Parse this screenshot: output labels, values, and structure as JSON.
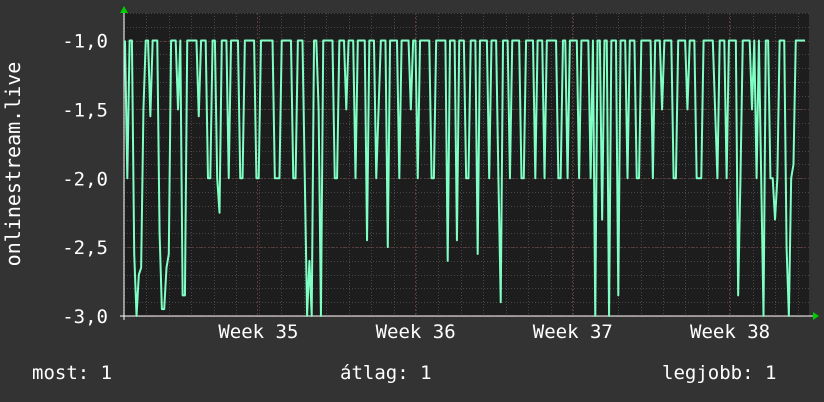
{
  "chart_data": {
    "type": "line",
    "ylabel": "onlinestream.live",
    "y_ticks": [
      "-1,0",
      "-1,5",
      "-2,0",
      "-2,5",
      "-3,0"
    ],
    "y_tick_values": [
      -1.0,
      -1.5,
      -2.0,
      -2.5,
      -3.0
    ],
    "ylim": [
      -3.0,
      -0.8
    ],
    "x_ticks": [
      "Week 35",
      "Week 36",
      "Week 37",
      "Week 38"
    ],
    "x_tick_positions_days": [
      5.94,
      12.94,
      19.94,
      26.94
    ],
    "xlim_days": [
      0,
      30.5
    ],
    "grid": true,
    "colors": {
      "background": "#333333",
      "plot": "#1d1d1d",
      "line": "#7fffc4",
      "axis_arrow": "#00cc00",
      "grid": "#474747"
    },
    "series": [
      {
        "values": [
          -1.0,
          -2.0,
          -1.0,
          -1.0,
          -2.55,
          -3.0,
          -2.7,
          -2.65,
          -1.5,
          -1.0,
          -1.0,
          -1.55,
          -1.0,
          -1.0,
          -1.0,
          -2.4,
          -2.95,
          -2.95,
          -2.65,
          -2.55,
          -1.0,
          -1.0,
          -1.0,
          -1.5,
          -1.0,
          -2.85,
          -2.85,
          -1.0,
          -1.0,
          -1.0,
          -1.0,
          -1.0,
          -1.55,
          -1.0,
          -1.0,
          -1.0,
          -2.0,
          -2.0,
          -1.0,
          -1.0,
          -2.0,
          -2.25,
          -1.0,
          -1.0,
          -1.0,
          -2.0,
          -1.0,
          -1.0,
          -1.0,
          -1.0,
          -2.0,
          -2.0,
          -1.0,
          -1.0,
          -1.0,
          -1.0,
          -1.0,
          -2.0,
          -2.0,
          -1.0,
          -1.0,
          -1.0,
          -1.0,
          -1.0,
          -1.0,
          -2.0,
          -2.0,
          -2.0,
          -1.0,
          -1.0,
          -1.0,
          -1.0,
          -1.0,
          -2.0,
          -2.0,
          -1.0,
          -1.0,
          -1.0,
          -2.0,
          -3.0,
          -2.6,
          -3.0,
          -1.0,
          -1.0,
          -1.5,
          -3.0,
          -1.0,
          -1.0,
          -1.0,
          -1.0,
          -1.0,
          -2.0,
          -2.0,
          -1.0,
          -1.0,
          -1.0,
          -1.5,
          -1.0,
          -1.0,
          -1.0,
          -2.0,
          -1.0,
          -1.0,
          -1.0,
          -1.0,
          -2.45,
          -1.0,
          -1.0,
          -1.0,
          -2.0,
          -1.5,
          -1.0,
          -1.0,
          -1.0,
          -2.5,
          -1.0,
          -1.0,
          -1.0,
          -1.0,
          -2.0,
          -1.0,
          -1.0,
          -1.0,
          -1.0,
          -1.5,
          -1.0,
          -1.0,
          -2.0,
          -1.0,
          -1.0,
          -1.0,
          -1.0,
          -1.0,
          -2.0,
          -2.0,
          -1.0,
          -1.0,
          -1.0,
          -1.0,
          -1.0,
          -2.6,
          -1.0,
          -1.0,
          -1.0,
          -2.45,
          -1.0,
          -1.0,
          -1.0,
          -2.0,
          -2.0,
          -1.0,
          -1.0,
          -1.0,
          -2.55,
          -1.0,
          -1.0,
          -1.0,
          -1.0,
          -2.0,
          -1.0,
          -1.0,
          -1.0,
          -2.0,
          -2.9,
          -1.0,
          -1.0,
          -1.0,
          -2.0,
          -1.0,
          -1.0,
          -1.0,
          -1.0,
          -2.0,
          -2.0,
          -1.0,
          -1.0,
          -1.0,
          -1.0,
          -2.0,
          -1.0,
          -1.0,
          -1.0,
          -2.0,
          -1.0,
          -1.0,
          -1.0,
          -1.0,
          -1.0,
          -2.0,
          -2.0,
          -1.0,
          -1.0,
          -2.0,
          -1.0,
          -1.0,
          -1.0,
          -1.0,
          -2.0,
          -1.0,
          -1.0,
          -1.0,
          -1.0,
          -2.0,
          -1.0,
          -3.0,
          -1.0,
          -1.0,
          -2.3,
          -1.0,
          -1.0,
          -3.0,
          -1.0,
          -1.0,
          -1.0,
          -2.85,
          -1.0,
          -1.0,
          -1.0,
          -2.0,
          -1.0,
          -1.0,
          -1.0,
          -2.0,
          -2.0,
          -1.0,
          -1.0,
          -1.0,
          -1.0,
          -1.0,
          -2.0,
          -1.0,
          -1.0,
          -1.0,
          -1.5,
          -1.0,
          -1.0,
          -1.0,
          -1.0,
          -2.0,
          -2.0,
          -1.0,
          -1.0,
          -1.0,
          -1.0,
          -1.5,
          -1.0,
          -1.0,
          -1.0,
          -2.0,
          -2.0,
          -2.0,
          -1.0,
          -1.0,
          -1.0,
          -1.0,
          -1.0,
          -1.5,
          -2.0,
          -1.0,
          -1.0,
          -1.0,
          -2.0,
          -1.0,
          -1.0,
          -1.0,
          -1.0,
          -2.85,
          -2.0,
          -1.0,
          -1.0,
          -1.0,
          -1.0,
          -1.5,
          -1.0,
          -2.0,
          -1.0,
          -2.0,
          -3.0,
          -1.0,
          -1.0,
          -2.0,
          -2.0,
          -2.3,
          -2.0,
          -1.0,
          -1.0,
          -1.0,
          -2.5,
          -3.0,
          -2.0,
          -1.9,
          -1.0,
          -1.0,
          -1.0,
          -1.0,
          -1.0
        ]
      }
    ]
  },
  "stats": {
    "current": "most: 1",
    "average": "átlag: 1",
    "maximum": "legjobb: 1"
  }
}
